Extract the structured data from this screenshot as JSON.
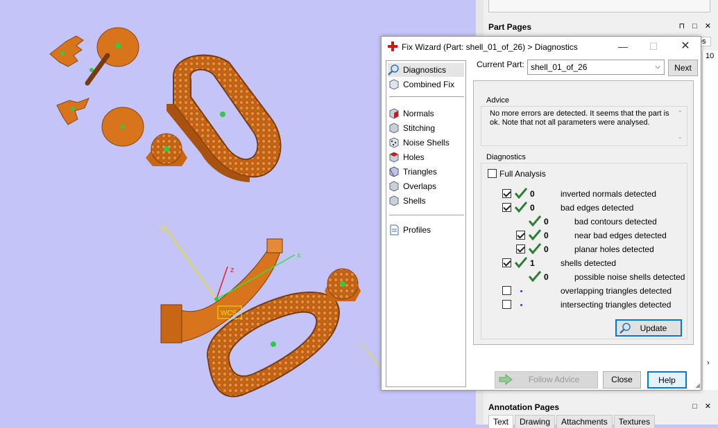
{
  "dialog": {
    "title": "Fix Wizard (Part: shell_01_of_26) > Diagnostics",
    "current_part_label": "Current Part:",
    "current_part_value": "shell_01_of_26",
    "next_label": "Next",
    "nav_items": [
      "Diagnostics",
      "Combined Fix",
      "Normals",
      "Stitching",
      "Noise Shells",
      "Holes",
      "Triangles",
      "Overlaps",
      "Shells",
      "Profiles"
    ],
    "advice_label": "Advice",
    "advice_text": "No more errors are detected. It seems that the part is ok. Note that not all parameters were analysed.",
    "diagnostics_label": "Diagnostics",
    "full_analysis_label": "Full Analysis",
    "rows": [
      {
        "count": "0",
        "label": "inverted normals detected",
        "checked": true
      },
      {
        "count": "0",
        "label": "bad edges detected",
        "checked": true
      },
      {
        "count": "0",
        "label": "bad contours detected",
        "checked": null
      },
      {
        "count": "0",
        "label": "near bad edges detected",
        "checked": true
      },
      {
        "count": "0",
        "label": "planar holes detected",
        "checked": true
      },
      {
        "count": "1",
        "label": "shells detected",
        "checked": true
      },
      {
        "count": "0",
        "label": "possible noise shells detected",
        "checked": null
      },
      {
        "count": "",
        "label": "overlapping triangles detected",
        "checked": false
      },
      {
        "count": "",
        "label": "intersecting triangles detected",
        "checked": false
      }
    ],
    "update_label": "Update",
    "follow_advice_label": "Follow Advice",
    "close_label": "Close",
    "help_label": "Help"
  },
  "dock": {
    "part_pages_title": "Part Pages",
    "annotation_pages_title": "Annotation Pages",
    "annotation_tabs": [
      "Text",
      "Drawing",
      "Attachments",
      "Textures"
    ],
    "partial_tab_text": "es",
    "partial_number": "10",
    "panel_controls": "⊓ □ ✕"
  },
  "viewport": {
    "axis_x": "x",
    "axis_y": "y",
    "axis_z": "z",
    "wcs_label": "WCS"
  },
  "colors": {
    "viewport_bg": "#c4c4f8",
    "part_orange": "#d8741c",
    "accent_blue": "#0078d7",
    "check_green": "#2e7d32"
  }
}
